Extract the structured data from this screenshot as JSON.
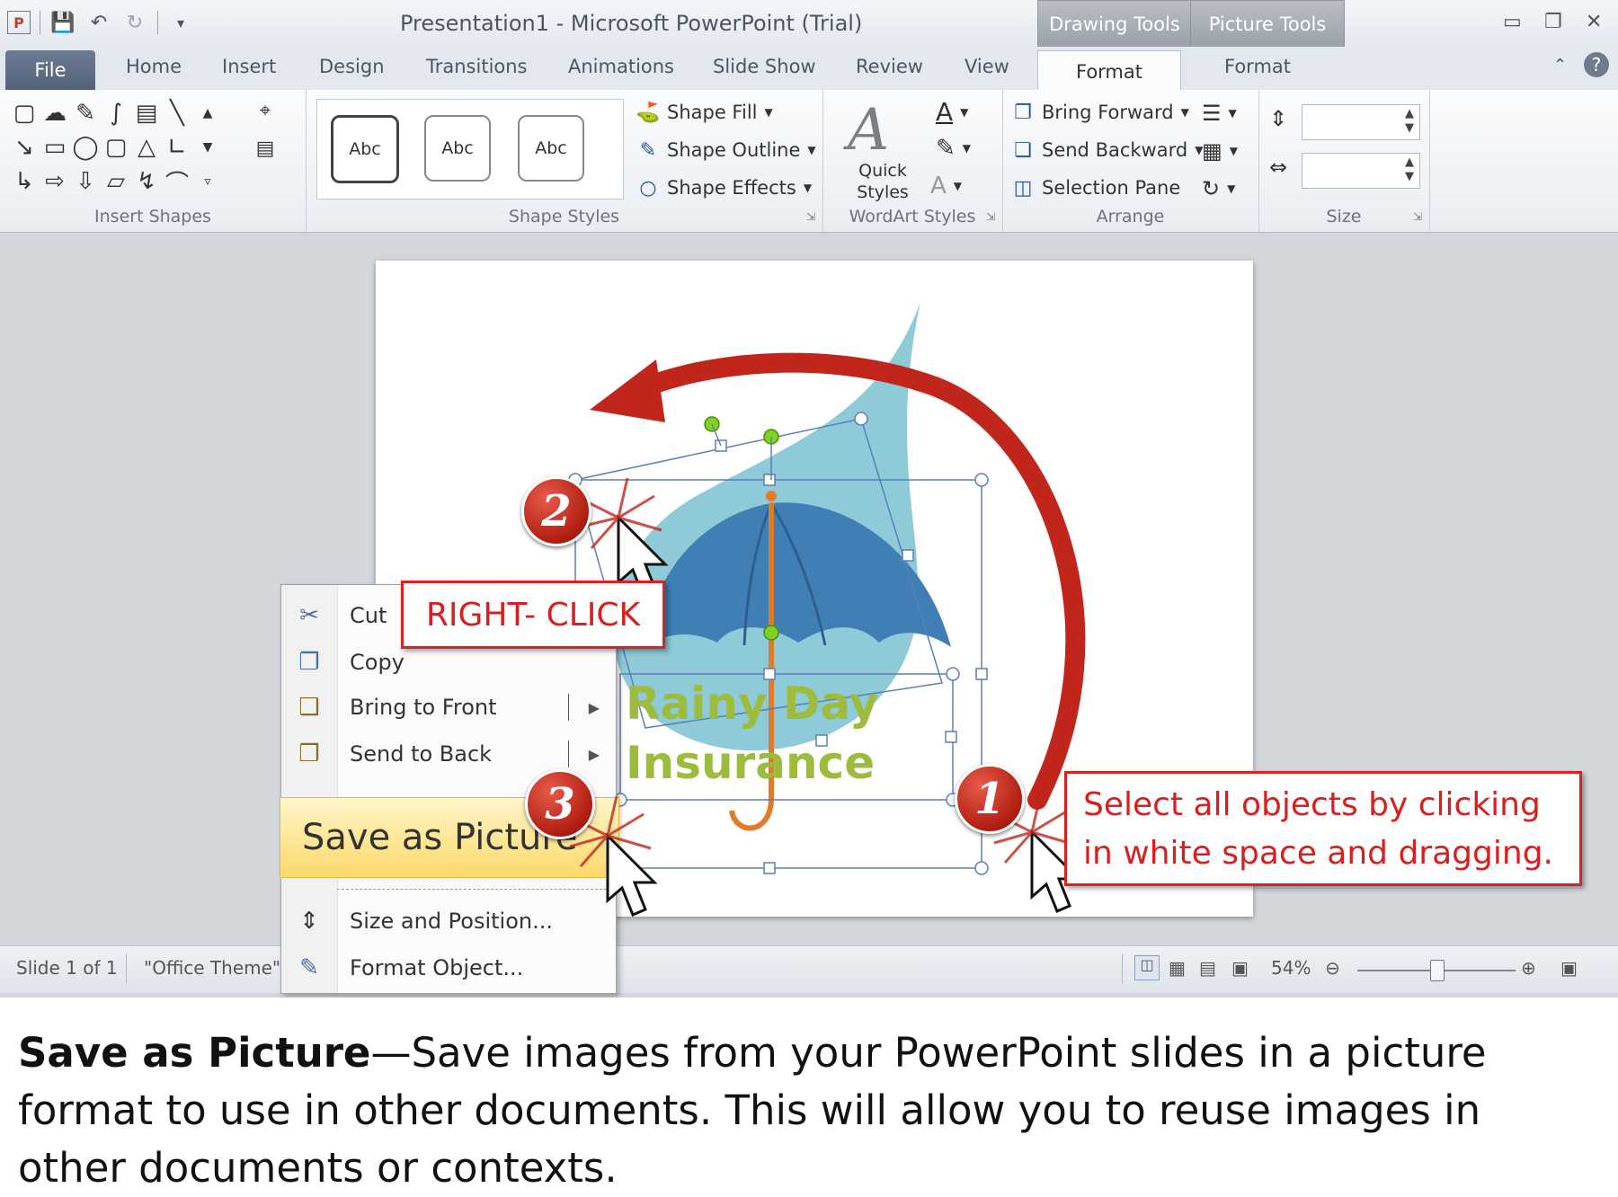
{
  "window": {
    "title": "Presentation1  -  Microsoft PowerPoint (Trial)",
    "context_tabs": [
      "Drawing Tools",
      "Picture Tools"
    ]
  },
  "tabs": {
    "file": "File",
    "items": [
      "Home",
      "Insert",
      "Design",
      "Transitions",
      "Animations",
      "Slide Show",
      "Review",
      "View"
    ],
    "format_drawing": "Format",
    "format_picture": "Format"
  },
  "ribbon": {
    "insert_shapes": {
      "label": "Insert Shapes"
    },
    "shape_styles": {
      "label": "Shape Styles",
      "swatches": [
        "Abc",
        "Abc",
        "Abc"
      ],
      "shape_fill": "Shape Fill",
      "shape_outline": "Shape Outline",
      "shape_effects": "Shape Effects"
    },
    "wordart_styles": {
      "label": "WordArt Styles",
      "quick_styles": "Quick Styles"
    },
    "arrange": {
      "label": "Arrange",
      "bring_forward": "Bring Forward",
      "send_backward": "Send Backward",
      "selection_pane": "Selection Pane"
    },
    "size": {
      "label": "Size"
    }
  },
  "slide": {
    "text_line1": "Rainy Day",
    "text_line2": "Insurance"
  },
  "context_menu": {
    "items": [
      {
        "label": "Cut",
        "icon": "scissors-icon"
      },
      {
        "label": "Copy",
        "icon": "copy-icon"
      },
      {
        "label": "Bring to Front",
        "icon": "bring-front-icon"
      },
      {
        "label": "Send to Back",
        "icon": "send-back-icon"
      }
    ],
    "highlighted": "Save as Picture",
    "bottom_items": [
      {
        "label": "Size and Position...",
        "icon": "size-position-icon"
      },
      {
        "label": "Format Object...",
        "icon": "format-object-icon"
      }
    ]
  },
  "callouts": {
    "right_click": "RIGHT- CLICK",
    "select_line1": "Select all objects by clicking",
    "select_line2": "in white space and dragging.",
    "steps": [
      "1",
      "2",
      "3"
    ]
  },
  "statusbar": {
    "slide": "Slide 1 of 1",
    "theme": "\"Office Theme\"",
    "zoom": "54%",
    "zoom_fraction": 0.5
  },
  "caption": {
    "bold": "Save as Picture",
    "text": "—Save images from your PowerPoint slides in a picture format to use in other documents.  This will allow you to reuse images in other documents or contexts."
  },
  "colors": {
    "accent_red": "#d81e1e",
    "wordart_green": "#9dbb3c",
    "drop_blue": "#8ecad8",
    "umbrella_blue": "#3f7fb6"
  }
}
